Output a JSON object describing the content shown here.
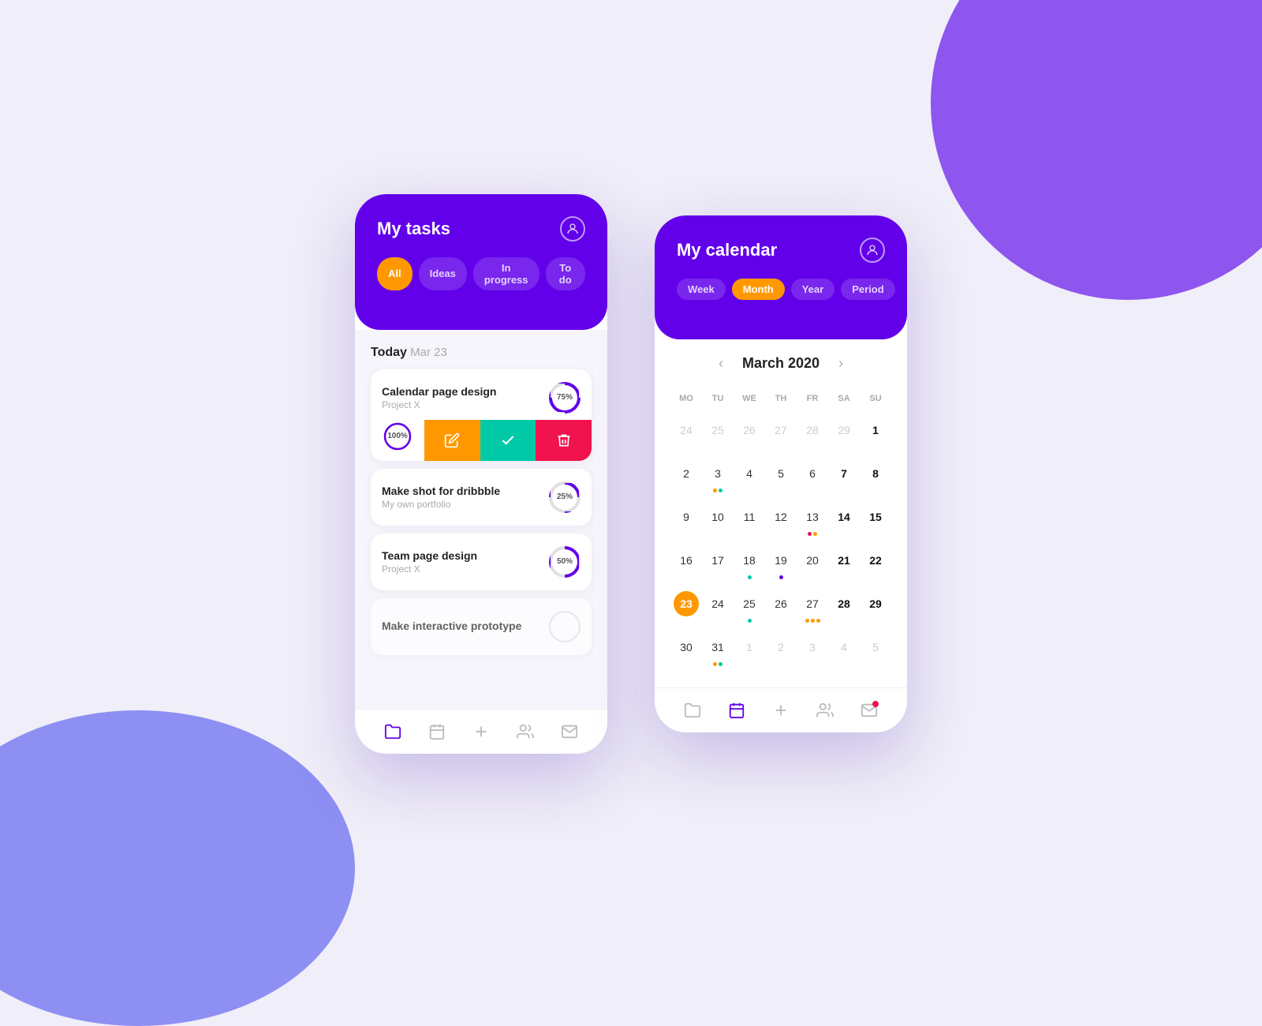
{
  "background": {
    "color": "#f0eef8"
  },
  "tasks_phone": {
    "header": {
      "title": "My tasks",
      "avatar_label": "user avatar"
    },
    "filters": [
      {
        "label": "All",
        "active": true
      },
      {
        "label": "Ideas",
        "active": false
      },
      {
        "label": "In progress",
        "active": false
      },
      {
        "label": "To do",
        "active": false
      }
    ],
    "today_label": "Today",
    "today_date": "Mar 23",
    "tasks": [
      {
        "name": "Calendar page design",
        "project": "Project X",
        "progress": 75,
        "progress_label": "75%",
        "expanded": true
      },
      {
        "name": "Make shot for dribbble",
        "project": "My own portfolio",
        "progress": 25,
        "progress_label": "25%",
        "expanded": false
      },
      {
        "name": "Team page design",
        "project": "Project X",
        "progress": 50,
        "progress_label": "50%",
        "expanded": false
      },
      {
        "name": "Make interactive prototype",
        "project": "",
        "progress": 0,
        "progress_label": "",
        "expanded": false
      }
    ],
    "expanded_task_progress": "100%",
    "action_buttons": [
      "edit",
      "done",
      "delete"
    ],
    "nav": [
      {
        "icon": "folder",
        "active": true
      },
      {
        "icon": "calendar"
      },
      {
        "icon": "plus"
      },
      {
        "icon": "people"
      },
      {
        "icon": "mail"
      }
    ]
  },
  "calendar_phone": {
    "header": {
      "title": "My calendar",
      "avatar_label": "user avatar"
    },
    "filters": [
      {
        "label": "Week",
        "active": false
      },
      {
        "label": "Month",
        "active": true
      },
      {
        "label": "Year",
        "active": false
      },
      {
        "label": "Period",
        "active": false
      }
    ],
    "calendar": {
      "month_title": "March 2020",
      "prev_label": "‹",
      "next_label": "›",
      "weekdays": [
        "MO",
        "TU",
        "WE",
        "TH",
        "FR",
        "SA",
        "SU"
      ],
      "weeks": [
        [
          {
            "day": "24",
            "dimmed": true,
            "dots": []
          },
          {
            "day": "25",
            "dimmed": true,
            "dots": []
          },
          {
            "day": "26",
            "dimmed": true,
            "dots": []
          },
          {
            "day": "27",
            "dimmed": true,
            "dots": []
          },
          {
            "day": "28",
            "dimmed": true,
            "dots": []
          },
          {
            "day": "29",
            "dimmed": true,
            "dots": []
          },
          {
            "day": "1",
            "bold": true,
            "dots": []
          }
        ],
        [
          {
            "day": "2",
            "dots": []
          },
          {
            "day": "3",
            "dots": [
              "orange",
              "green"
            ]
          },
          {
            "day": "4",
            "dots": []
          },
          {
            "day": "5",
            "dots": []
          },
          {
            "day": "6",
            "dots": []
          },
          {
            "day": "7",
            "bold": true,
            "dots": []
          },
          {
            "day": "8",
            "bold": true,
            "dots": []
          }
        ],
        [
          {
            "day": "9",
            "dots": []
          },
          {
            "day": "10",
            "dots": []
          },
          {
            "day": "11",
            "dots": []
          },
          {
            "day": "12",
            "dots": []
          },
          {
            "day": "13",
            "dots": [
              "red",
              "orange"
            ]
          },
          {
            "day": "14",
            "bold": true,
            "dots": []
          },
          {
            "day": "15",
            "bold": true,
            "dots": []
          }
        ],
        [
          {
            "day": "16",
            "dots": []
          },
          {
            "day": "17",
            "dots": []
          },
          {
            "day": "18",
            "dots": [
              "green"
            ]
          },
          {
            "day": "19",
            "dots": [
              "purple"
            ]
          },
          {
            "day": "20",
            "dots": []
          },
          {
            "day": "21",
            "bold": true,
            "dots": []
          },
          {
            "day": "22",
            "bold": true,
            "dots": []
          }
        ],
        [
          {
            "day": "23",
            "today": true,
            "dots": []
          },
          {
            "day": "24",
            "dots": []
          },
          {
            "day": "25",
            "dots": [
              "green"
            ]
          },
          {
            "day": "26",
            "dots": []
          },
          {
            "day": "27",
            "dots": [
              "orange",
              "orange",
              "orange"
            ]
          },
          {
            "day": "28",
            "bold": true,
            "dots": []
          },
          {
            "day": "29",
            "bold": true,
            "dots": []
          }
        ],
        [
          {
            "day": "30",
            "dots": []
          },
          {
            "day": "31",
            "dots": [
              "orange",
              "green"
            ]
          },
          {
            "day": "1",
            "dimmed": true,
            "dots": []
          },
          {
            "day": "2",
            "dimmed": true,
            "dots": []
          },
          {
            "day": "3",
            "dimmed": true,
            "dots": []
          },
          {
            "day": "4",
            "dimmed": true,
            "dots": []
          },
          {
            "day": "5",
            "dimmed": true,
            "dots": []
          }
        ]
      ]
    },
    "nav": [
      {
        "icon": "folder"
      },
      {
        "icon": "calendar",
        "active": true
      },
      {
        "icon": "plus"
      },
      {
        "icon": "people"
      },
      {
        "icon": "mail",
        "badge": true
      }
    ]
  }
}
